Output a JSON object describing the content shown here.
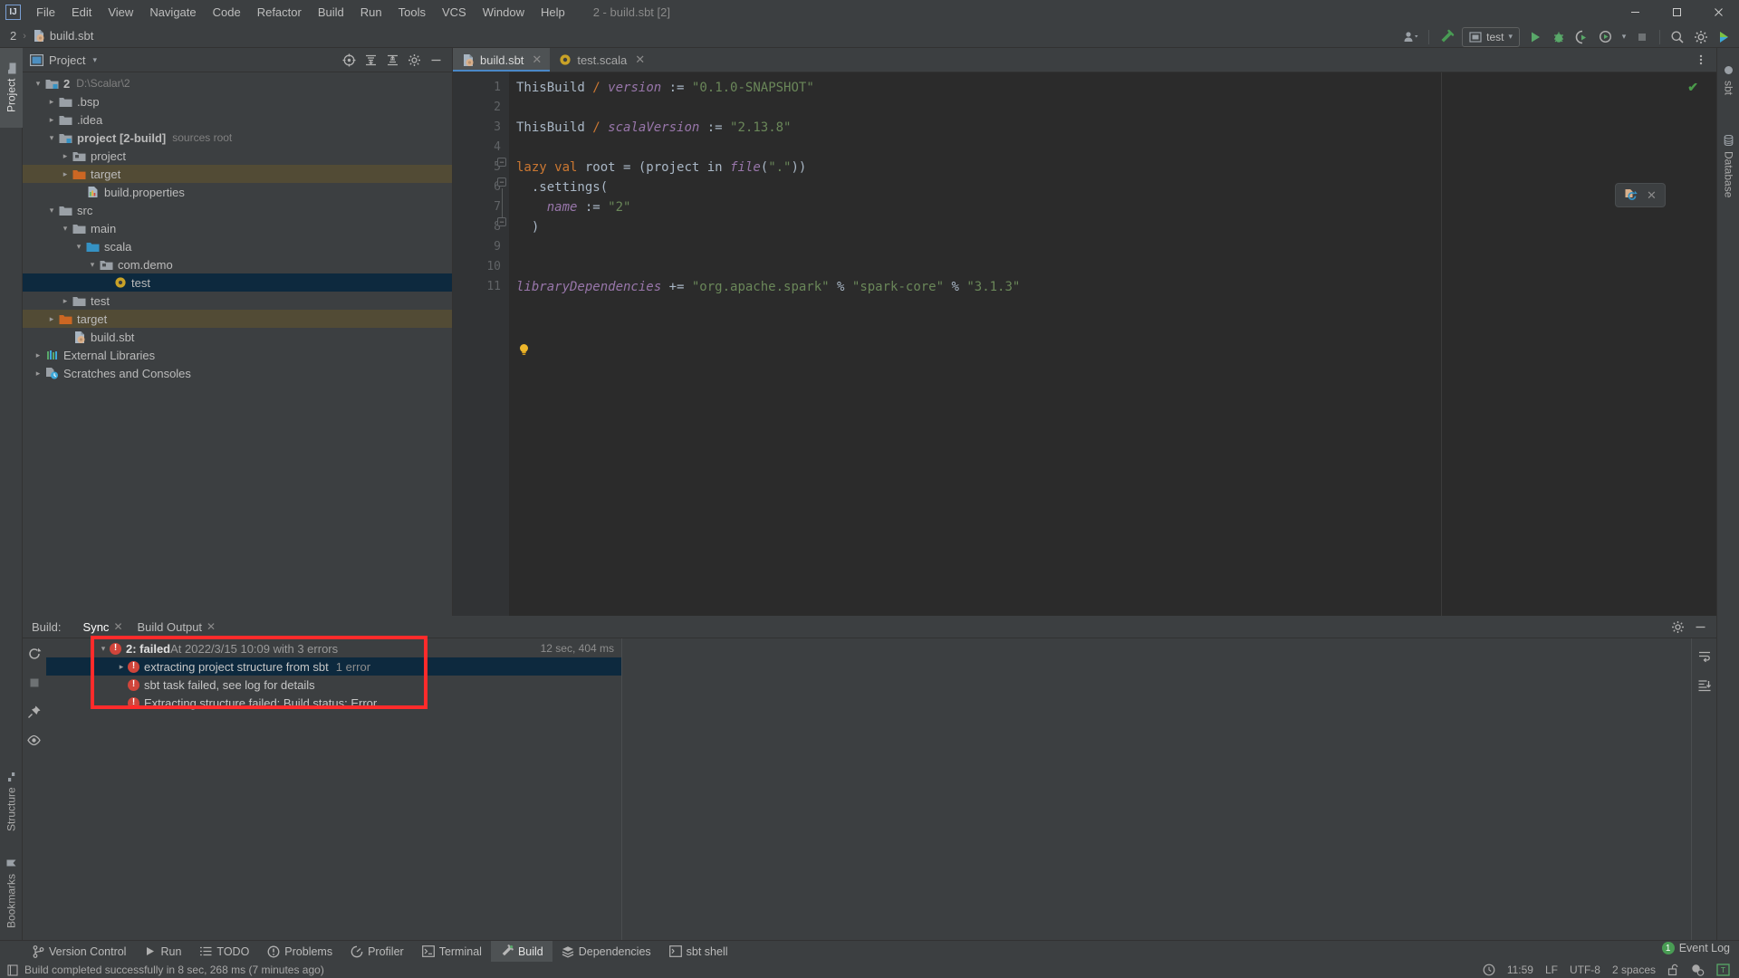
{
  "window": {
    "title": "2 - build.sbt [2]",
    "controls": {
      "minimize": "—",
      "maximize": "□",
      "close": "✕"
    }
  },
  "menubar": {
    "items": [
      "File",
      "Edit",
      "View",
      "Navigate",
      "Code",
      "Refactor",
      "Build",
      "Run",
      "Tools",
      "VCS",
      "Window",
      "Help"
    ]
  },
  "navbar": {
    "crumbs": [
      "2",
      "build.sbt"
    ],
    "separator": "›"
  },
  "toolbar_right": {
    "run_config": "test",
    "icons": [
      "user-icon",
      "hammer-icon",
      "run-icon",
      "debug-icon",
      "run-coverage-icon",
      "profile-icon",
      "stop-icon",
      "search-everywhere-icon",
      "settings-icon",
      "updates-icon"
    ]
  },
  "left_strip": {
    "tabs": [
      {
        "label": "Project",
        "active": true
      },
      {
        "label": "Structure",
        "active": false
      },
      {
        "label": "Bookmarks",
        "active": false
      }
    ]
  },
  "right_strip": {
    "tabs": [
      {
        "label": "sbt",
        "active": false
      },
      {
        "label": "Database",
        "active": false
      }
    ]
  },
  "project_panel": {
    "title": "Project",
    "chevron": "▾",
    "actions": [
      "select-opened-file-icon",
      "expand-all-icon",
      "collapse-all-icon",
      "settings-icon",
      "hide-icon"
    ],
    "tree": [
      {
        "indent": 0,
        "arrow": "⌄",
        "icon": "module-folder",
        "label": "2",
        "bold": true,
        "sub": "D:\\Scalar\\2",
        "state": "normal"
      },
      {
        "indent": 1,
        "arrow": "›",
        "icon": "folder-gray",
        "label": ".bsp",
        "sub": "",
        "state": "normal"
      },
      {
        "indent": 1,
        "arrow": "›",
        "icon": "folder-gray",
        "label": ".idea",
        "sub": "",
        "state": "normal"
      },
      {
        "indent": 1,
        "arrow": "⌄",
        "icon": "module-folder",
        "label": "project [2-build]",
        "bold": true,
        "sub": "sources root",
        "state": "normal"
      },
      {
        "indent": 2,
        "arrow": "›",
        "icon": "folder-pkg",
        "label": "project",
        "sub": "",
        "state": "normal"
      },
      {
        "indent": 2,
        "arrow": "›",
        "icon": "folder-orange",
        "label": "target",
        "sub": "",
        "state": "excluded"
      },
      {
        "indent": 3,
        "arrow": "",
        "icon": "properties-file",
        "label": "build.properties",
        "sub": "",
        "state": "normal"
      },
      {
        "indent": 1,
        "arrow": "⌄",
        "icon": "folder-gray",
        "label": "src",
        "sub": "",
        "state": "normal"
      },
      {
        "indent": 2,
        "arrow": "⌄",
        "icon": "folder-gray",
        "label": "main",
        "sub": "",
        "state": "normal"
      },
      {
        "indent": 3,
        "arrow": "⌄",
        "icon": "folder-blue",
        "label": "scala",
        "sub": "",
        "state": "normal"
      },
      {
        "indent": 4,
        "arrow": "⌄",
        "icon": "folder-pkg",
        "label": "com.demo",
        "sub": "",
        "state": "normal"
      },
      {
        "indent": 5,
        "arrow": "",
        "icon": "scala-object",
        "label": "test",
        "sub": "",
        "state": "selected"
      },
      {
        "indent": 2,
        "arrow": "›",
        "icon": "folder-gray",
        "label": "test",
        "sub": "",
        "state": "normal"
      },
      {
        "indent": 1,
        "arrow": "›",
        "icon": "folder-orange",
        "label": "target",
        "sub": "",
        "state": "excluded"
      },
      {
        "indent": 2,
        "arrow": "",
        "icon": "sbt-file",
        "label": "build.sbt",
        "sub": "",
        "state": "normal"
      },
      {
        "indent": 0,
        "arrow": "›",
        "icon": "libraries",
        "label": "External Libraries",
        "sub": "",
        "state": "normal"
      },
      {
        "indent": 0,
        "arrow": "›",
        "icon": "scratches",
        "label": "Scratches and Consoles",
        "sub": "",
        "state": "normal"
      }
    ]
  },
  "editor": {
    "tabs": [
      {
        "label": "build.sbt",
        "icon": "sbt-file-icon",
        "active": true
      },
      {
        "label": "test.scala",
        "icon": "scala-object-icon",
        "active": false
      }
    ],
    "close_glyph": "✕",
    "more_icon": "more-vertical-icon",
    "inspection_status": "✔",
    "reload_widget": {
      "icon": "sbt-reload-icon",
      "close": "✕"
    },
    "line_numbers": [
      "1",
      "2",
      "3",
      "4",
      "5",
      "6",
      "7",
      "8",
      "9",
      "10",
      "11"
    ],
    "lines": [
      {
        "n": 1,
        "tokens": [
          {
            "t": "ThisBuild ",
            "c": "ident"
          },
          {
            "t": "/",
            "c": "kw"
          },
          {
            "t": " ",
            "c": "ident"
          },
          {
            "t": "version",
            "c": "fld"
          },
          {
            "t": " := ",
            "c": "op"
          },
          {
            "t": "\"0.1.0-SNAPSHOT\"",
            "c": "str"
          }
        ]
      },
      {
        "n": 2,
        "tokens": []
      },
      {
        "n": 3,
        "tokens": [
          {
            "t": "ThisBuild ",
            "c": "ident"
          },
          {
            "t": "/",
            "c": "kw"
          },
          {
            "t": " ",
            "c": "ident"
          },
          {
            "t": "scalaVersion",
            "c": "fld"
          },
          {
            "t": " := ",
            "c": "op"
          },
          {
            "t": "\"2.13.8\"",
            "c": "str"
          }
        ]
      },
      {
        "n": 4,
        "tokens": []
      },
      {
        "n": 5,
        "tokens": [
          {
            "t": "lazy",
            "c": "kw"
          },
          {
            "t": " ",
            "c": "ident"
          },
          {
            "t": "val",
            "c": "kw"
          },
          {
            "t": " root = (project in ",
            "c": "ident"
          },
          {
            "t": "file",
            "c": "fld"
          },
          {
            "t": "(",
            "c": "ident"
          },
          {
            "t": "\".\"",
            "c": "str"
          },
          {
            "t": "))",
            "c": "ident"
          }
        ]
      },
      {
        "n": 6,
        "tokens": [
          {
            "t": "  .settings(",
            "c": "ident"
          }
        ]
      },
      {
        "n": 7,
        "tokens": [
          {
            "t": "    ",
            "c": "ident"
          },
          {
            "t": "name",
            "c": "fld"
          },
          {
            "t": " := ",
            "c": "op"
          },
          {
            "t": "\"2\"",
            "c": "str"
          }
        ]
      },
      {
        "n": 8,
        "tokens": [
          {
            "t": "  )",
            "c": "ident"
          }
        ]
      },
      {
        "n": 9,
        "tokens": []
      },
      {
        "n": 10,
        "tokens": []
      },
      {
        "n": 11,
        "tokens": [
          {
            "t": "libraryDependencies",
            "c": "fld"
          },
          {
            "t": " += ",
            "c": "op"
          },
          {
            "t": "\"org.apache.spark\"",
            "c": "str"
          },
          {
            "t": " % ",
            "c": "op"
          },
          {
            "t": "\"spark-core\"",
            "c": "str"
          },
          {
            "t": " % ",
            "c": "op"
          },
          {
            "t": "\"3.1.3\"",
            "c": "str"
          }
        ]
      }
    ]
  },
  "build_panel": {
    "label": "Build:",
    "tabs": [
      {
        "label": "Sync",
        "active": true
      },
      {
        "label": "Build Output",
        "active": false
      }
    ],
    "close_glyph": "✕",
    "actions_left": [
      "rerun-icon",
      "stop-icon",
      "pin-icon",
      "show-icon"
    ],
    "actions_right": [
      "settings-icon",
      "hide-icon"
    ],
    "output_actions": [
      "soft-wrap-icon",
      "scroll-to-end-icon"
    ],
    "duration": "12 sec, 404 ms",
    "rows": [
      {
        "indent": 0,
        "arrow": "⌄",
        "error": true,
        "label_bold": "2: failed",
        "label": "At 2022/3/15 10:09 with 3 errors",
        "suffix": "",
        "selected": false
      },
      {
        "indent": 1,
        "arrow": "›",
        "error": true,
        "label_bold": "",
        "label": "extracting project structure from sbt",
        "suffix": "1 error",
        "selected": true
      },
      {
        "indent": 1,
        "arrow": "",
        "error": true,
        "label_bold": "",
        "label": "sbt task failed, see log for details",
        "suffix": "",
        "selected": false
      },
      {
        "indent": 1,
        "arrow": "",
        "error": true,
        "label_bold": "",
        "label": "Extracting structure failed: Build status: Error",
        "suffix": "",
        "selected": false
      }
    ],
    "highlight_color": "#ff2b2b"
  },
  "bottom_tools": [
    {
      "label": "Version Control",
      "icon": "branch-icon",
      "active": false
    },
    {
      "label": "Run",
      "icon": "run-icon",
      "active": false
    },
    {
      "label": "TODO",
      "icon": "todo-icon",
      "active": false
    },
    {
      "label": "Problems",
      "icon": "problems-icon",
      "active": false
    },
    {
      "label": "Profiler",
      "icon": "profiler-icon",
      "active": false
    },
    {
      "label": "Terminal",
      "icon": "terminal-icon",
      "active": false
    },
    {
      "label": "Build",
      "icon": "build-hammer-icon",
      "active": true
    },
    {
      "label": "Dependencies",
      "icon": "dependencies-icon",
      "active": false
    },
    {
      "label": "sbt shell",
      "icon": "sbt-shell-icon",
      "active": false
    }
  ],
  "event_log": {
    "label": "Event Log",
    "count": "1"
  },
  "statusbar": {
    "message": "Build completed successfully in 8 sec, 268 ms (7 minutes ago)",
    "message_icon": "log-icon",
    "time": "11:59",
    "line_separator": "LF",
    "encoding": "UTF-8",
    "indent": "2 spaces",
    "icons": [
      "clock-icon",
      "lock-open-icon",
      "inspection-icon",
      "tutorial-icon"
    ]
  },
  "colors": {
    "bg": "#3c3f41",
    "editor_bg": "#2b2b2b",
    "gutter_bg": "#313335",
    "selection": "#0d293e",
    "excluded_row": "#524b35",
    "accent_blue": "#4a88c7",
    "error_red": "#d0453b",
    "highlight_red": "#ff2b2b",
    "green": "#499c54",
    "string_green": "#6a8759",
    "keyword_orange": "#cc7832",
    "field_purple": "#9876aa"
  }
}
